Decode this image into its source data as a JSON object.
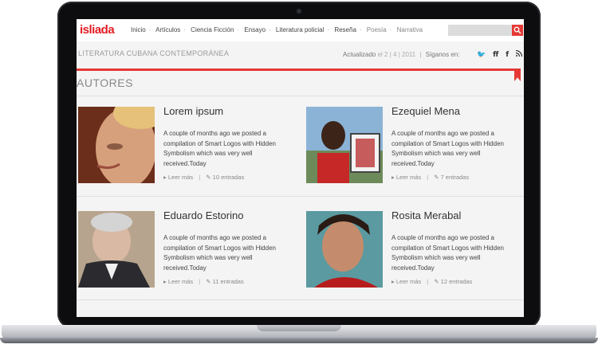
{
  "header": {
    "logo": "isliada",
    "nav": [
      "Inicio",
      "Artículos",
      "Ciencia Ficción",
      "Ensayo",
      "Literatura policial",
      "Reseña",
      "Poesía",
      "Narrativa"
    ],
    "search_placeholder": ""
  },
  "subheader": {
    "subtitle": "LITERATURA CUBANA  CONTEMPORÁNEA",
    "updated_label": "Actualizado",
    "updated_text": "el 2 | 4 | 2011",
    "follow_label": "Síganos en:",
    "social": [
      "twitter-icon",
      "friendfeed-icon",
      "facebook-icon",
      "rss-icon"
    ]
  },
  "section_title": "AUTORES",
  "authors": [
    {
      "name": "Lorem ipsum",
      "excerpt": "A couple of months ago we posted a compilation of Smart Logos with Hidden Symbolism which was very well received.Today",
      "read_more": "Leer más",
      "entries": "10 entradas"
    },
    {
      "name": "Ezequiel Mena",
      "excerpt": "A couple of months ago we posted a compilation of Smart Logos with Hidden Symbolism which was very well received.Today",
      "read_more": "Leer más",
      "entries": "7 entradas"
    },
    {
      "name": "Eduardo Estorino",
      "excerpt": "A couple of months ago we posted a compilation of Smart Logos with Hidden Symbolism which was very well received.Today",
      "read_more": "Leer más",
      "entries": "11 entradas"
    },
    {
      "name": "Rosita Merabal",
      "excerpt": "A couple of months ago we posted a compilation of Smart Logos with Hidden Symbolism which was very well received.Today",
      "read_more": "Leer más",
      "entries": "12 entradas"
    }
  ],
  "colors": {
    "accent": "#e53935",
    "logo": "#e31e24"
  }
}
